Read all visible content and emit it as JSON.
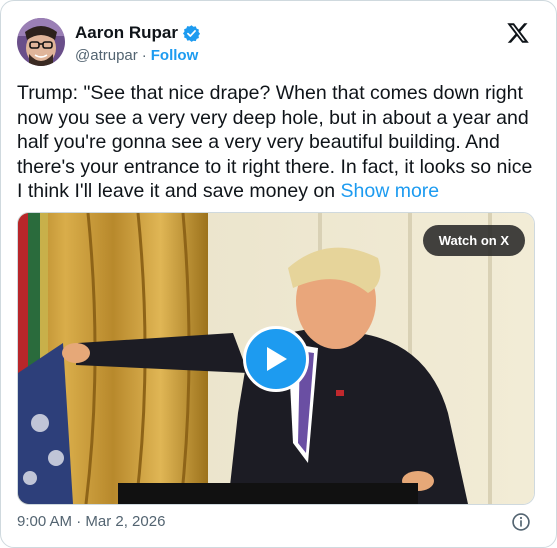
{
  "author": {
    "name": "Aaron Rupar",
    "handle": "@atrupar",
    "separator": "·",
    "follow_label": "Follow",
    "verified_icon": "verified-badge-icon",
    "verified_color": "#1d9bf0"
  },
  "tweet": {
    "text": "Trump: \"See that nice drape? When that comes down right now you see a very very deep hole, but in about a year and half you're gonna see a very very beautiful building. And there's your entrance to it right there. In fact, it looks so nice I think I'll leave it and save money on",
    "show_more_label": "Show more"
  },
  "media": {
    "watch_label": "Watch on X",
    "play_icon": "play-icon"
  },
  "footer": {
    "timestamp": "9:00 AM · Mar 2, 2026",
    "info_icon": "info-icon"
  },
  "colors": {
    "accent": "#1d9bf0",
    "text": "#0f1419",
    "muted": "#536471",
    "border": "#cfd9de"
  }
}
